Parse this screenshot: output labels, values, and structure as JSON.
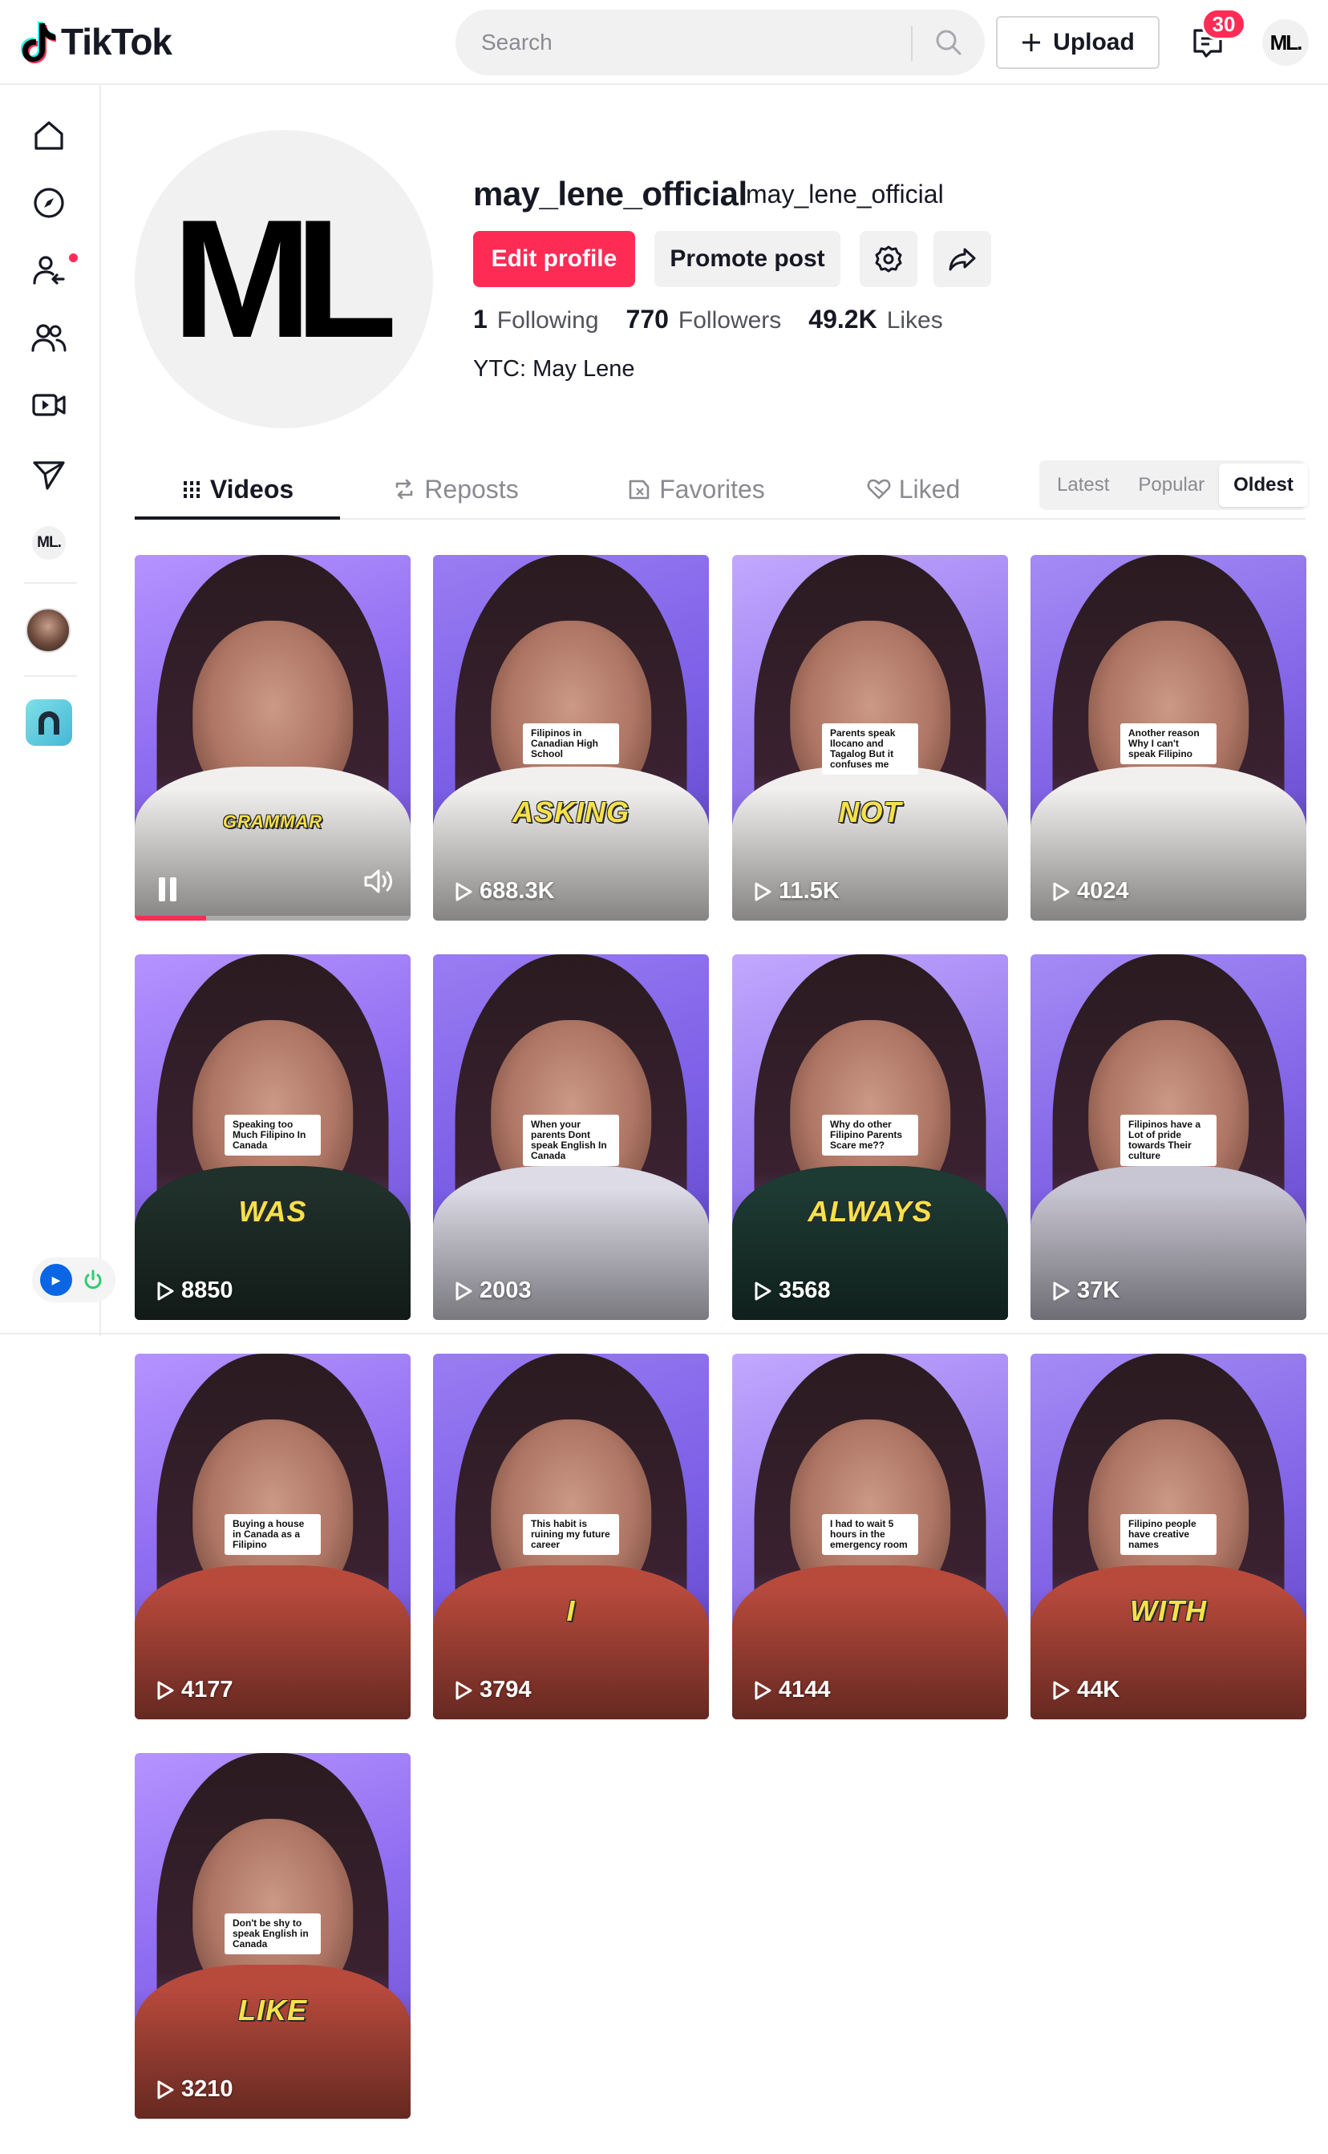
{
  "header": {
    "logo_text": "TikTok",
    "search_placeholder": "Search",
    "upload_label": "Upload",
    "inbox_count": "30",
    "account_initials": "ML."
  },
  "sidebar": {
    "items": [
      {
        "name": "home-icon"
      },
      {
        "name": "explore-icon"
      },
      {
        "name": "following-icon"
      },
      {
        "name": "friends-icon"
      },
      {
        "name": "live-icon"
      },
      {
        "name": "messages-icon"
      }
    ],
    "profile_initials": "ML."
  },
  "profile": {
    "avatar_initials": "ML",
    "username": "may_lene_official",
    "nickname": "may_lene_official",
    "edit_label": "Edit profile",
    "promote_label": "Promote post",
    "following_count": "1",
    "following_label": "Following",
    "followers_count": "770",
    "followers_label": "Followers",
    "likes_count": "49.2K",
    "likes_label": "Likes",
    "bio": "YTC: May Lene"
  },
  "tabs": [
    {
      "label": "Videos",
      "active": true
    },
    {
      "label": "Reposts",
      "active": false
    },
    {
      "label": "Favorites",
      "active": false
    },
    {
      "label": "Liked",
      "active": false
    }
  ],
  "sort": [
    {
      "label": "Latest",
      "active": false
    },
    {
      "label": "Popular",
      "active": false
    },
    {
      "label": "Oldest",
      "active": true
    }
  ],
  "videos": [
    {
      "views": "",
      "overlay": "GRAMMAR",
      "caption": "",
      "playing": true,
      "progress": 0.26,
      "shirt": "#f2f0ee"
    },
    {
      "views": "688.3K",
      "overlay": "ASKING",
      "caption": "Filipinos in Canadian High School",
      "playing": false,
      "shirt": "#f2f0ee"
    },
    {
      "views": "11.5K",
      "overlay": "NOT",
      "caption": "Parents speak Ilocano and Tagalog But it confuses me",
      "playing": false,
      "shirt": "#f2f0ee"
    },
    {
      "views": "4024",
      "overlay": "",
      "caption": "Another reason Why I can't speak Filipino",
      "playing": false,
      "shirt": "#f2f0ee"
    },
    {
      "views": "8850",
      "overlay": "WAS",
      "caption": "Speaking too Much Filipino In Canada",
      "playing": false,
      "shirt": "#20302a"
    },
    {
      "views": "2003",
      "overlay": "",
      "caption": "When your parents Dont speak English In Canada",
      "playing": false,
      "shirt": "#dcdbe6"
    },
    {
      "views": "3568",
      "overlay": "ALWAYS",
      "caption": "Why do other Filipino Parents Scare me??",
      "playing": false,
      "shirt": "#1d3a33"
    },
    {
      "views": "37K",
      "overlay": "",
      "caption": "Filipinos have a Lot of pride towards Their culture",
      "playing": false,
      "shirt": "#c9c6d3"
    },
    {
      "views": "4177",
      "overlay": "",
      "caption": "Buying a house in Canada as a Filipino",
      "playing": false,
      "shirt": "#b84a3c"
    },
    {
      "views": "3794",
      "overlay": "I",
      "caption": "This habit is ruining my future career",
      "playing": false,
      "shirt": "#b84a3c"
    },
    {
      "views": "4144",
      "overlay": "",
      "caption": "I had to wait 5 hours in the emergency room",
      "playing": false,
      "shirt": "#b84a3c"
    },
    {
      "views": "44K",
      "overlay": "WITH",
      "caption": "Filipino people have creative names",
      "playing": false,
      "shirt": "#b84a3c"
    },
    {
      "views": "3210",
      "overlay": "LIKE",
      "caption": "Don't be shy to speak English in Canada",
      "playing": false,
      "shirt": "#b84a3c"
    }
  ]
}
